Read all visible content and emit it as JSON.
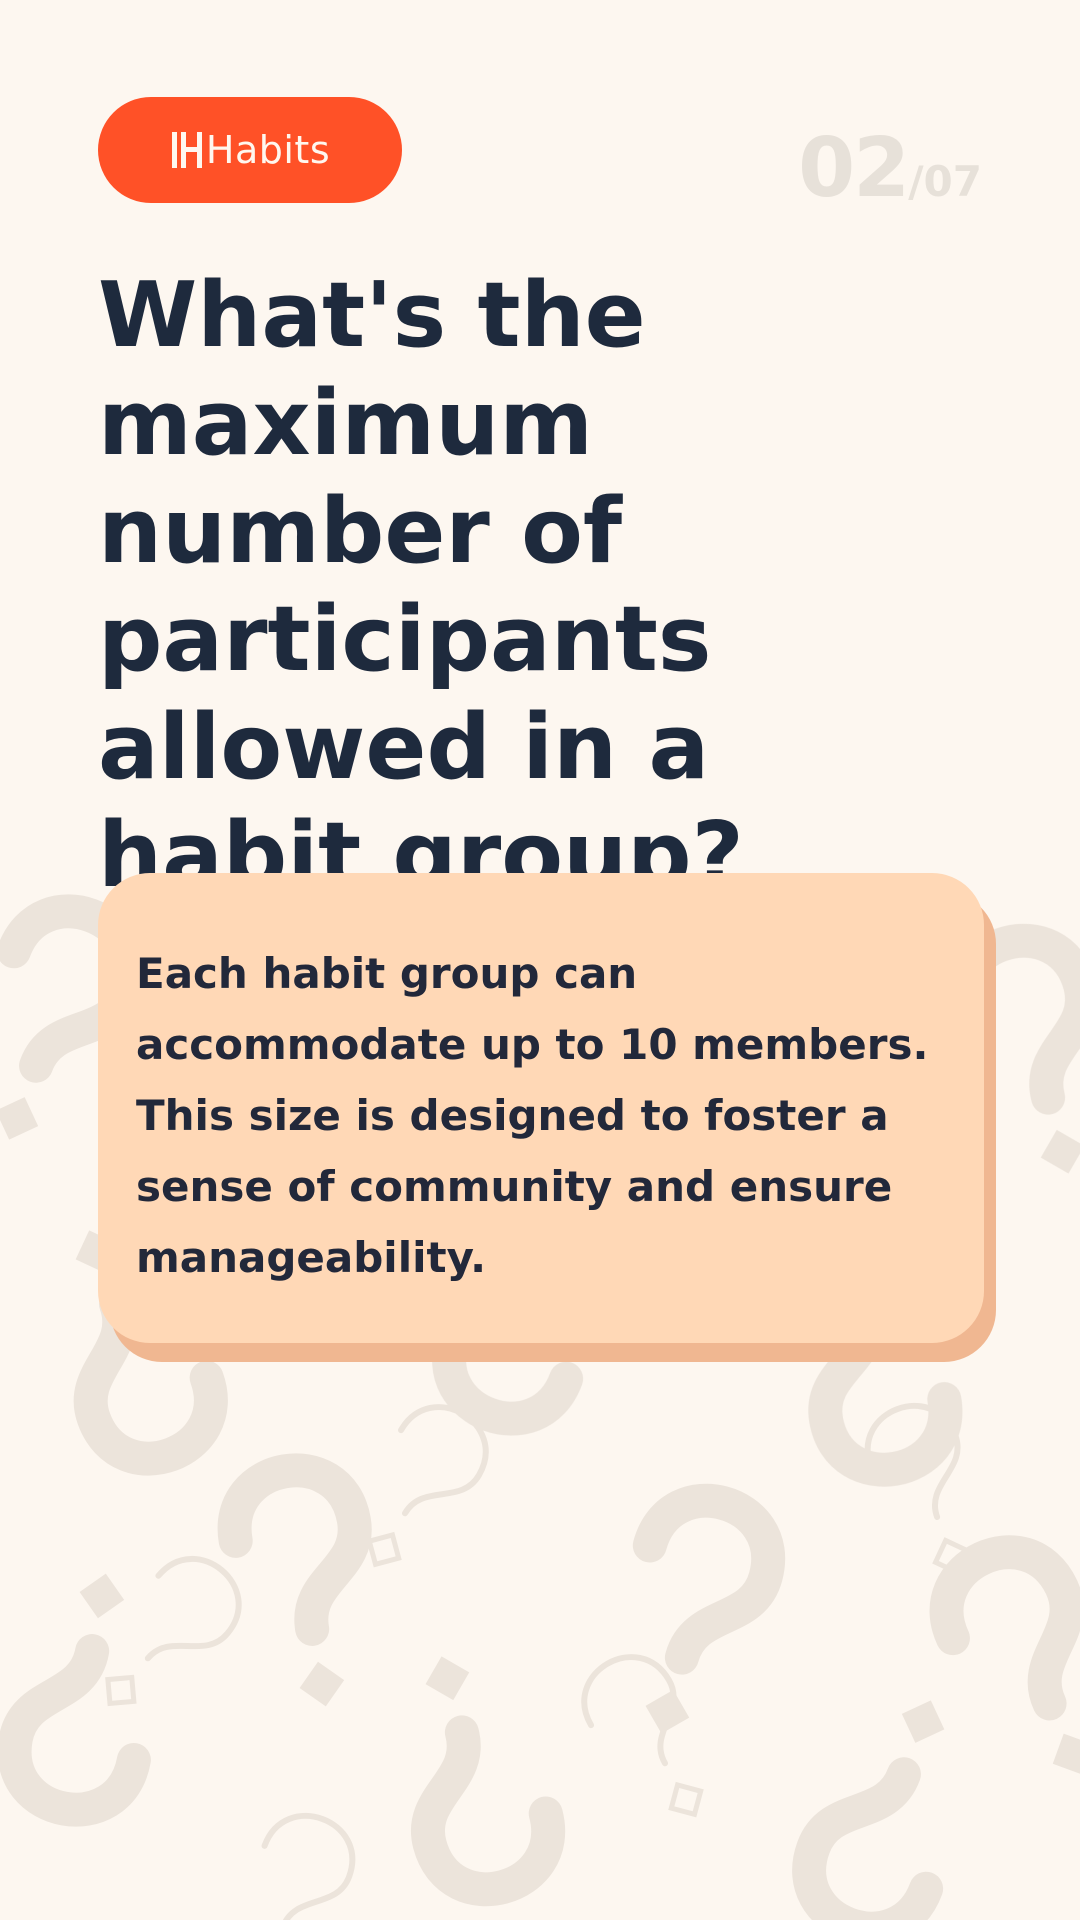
{
  "brand": {
    "name": "Habits",
    "pill_color": "#ff5127",
    "text_color": "#fff7ef"
  },
  "progress": {
    "current": "02",
    "separator": "/",
    "total": "07"
  },
  "question": "What's the maximum number of participants allowed in a habit group?",
  "answer": "Each habit group can accommodate up to 10 members. This size is designed to foster a sense of community and ensure manageability.",
  "colors": {
    "background": "#fdf7f0",
    "question_text": "#1e2a3d",
    "answer_card": "#ffd8b6",
    "answer_card_shadow": "#f0b791",
    "counter": "#e7e1d9",
    "pattern": "#ece5dd"
  },
  "decoration": {
    "background_pattern": "question-mark-pattern"
  }
}
